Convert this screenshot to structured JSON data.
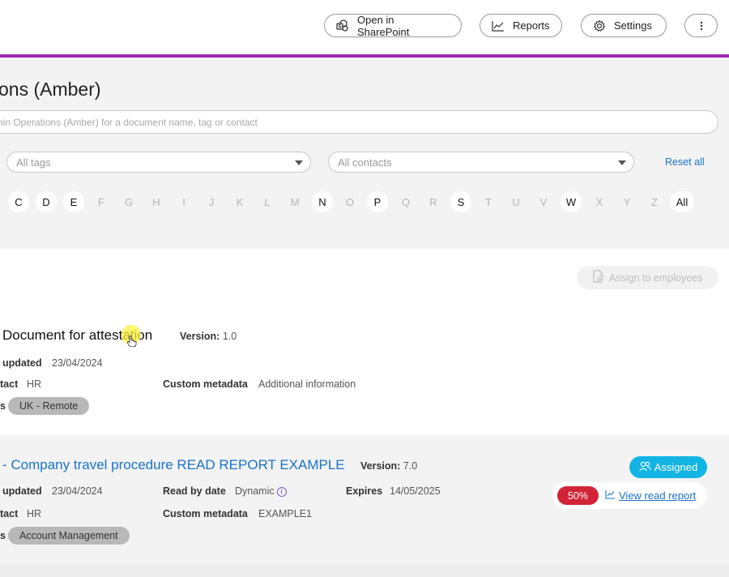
{
  "toolbar": {
    "open_sharepoint": "Open in SharePoint",
    "reports": "Reports",
    "settings": "Settings",
    "more_icon": "more-vertical-icon"
  },
  "filters": {
    "title": "ons (Amber)",
    "search_placeholder": "hin Operations (Amber) for a document name, tag or contact",
    "tags_placeholder": "All tags",
    "contacts_placeholder": "All contacts",
    "reset_all": "Reset all",
    "letters": [
      {
        "label": "C",
        "active": true
      },
      {
        "label": "D",
        "active": true
      },
      {
        "label": "E",
        "active": true
      },
      {
        "label": "F",
        "active": false
      },
      {
        "label": "G",
        "active": false
      },
      {
        "label": "H",
        "active": false
      },
      {
        "label": "I",
        "active": false
      },
      {
        "label": "J",
        "active": false
      },
      {
        "label": "K",
        "active": false
      },
      {
        "label": "L",
        "active": false
      },
      {
        "label": "M",
        "active": false
      },
      {
        "label": "N",
        "active": true
      },
      {
        "label": "O",
        "active": false
      },
      {
        "label": "P",
        "active": true
      },
      {
        "label": "Q",
        "active": false
      },
      {
        "label": "R",
        "active": false
      },
      {
        "label": "S",
        "active": true
      },
      {
        "label": "T",
        "active": false
      },
      {
        "label": "U",
        "active": false
      },
      {
        "label": "V",
        "active": false
      },
      {
        "label": "W",
        "active": true
      },
      {
        "label": "X",
        "active": false
      },
      {
        "label": "Y",
        "active": false
      },
      {
        "label": "Z",
        "active": false
      },
      {
        "label": "All",
        "active": true
      }
    ]
  },
  "actions": {
    "assign_label": "Assign to employees"
  },
  "documents": [
    {
      "title": "Document for attestation",
      "version_label": "Version:",
      "version": "1.0",
      "updated_label": "updated",
      "updated": "23/04/2024",
      "contact_label": "tact",
      "contact": "HR",
      "meta_label": "Custom metadata",
      "meta": "Additional information",
      "tags_label": "s",
      "tag": "UK - Remote"
    },
    {
      "title": "- Company travel procedure READ REPORT EXAMPLE",
      "version_label": "Version:",
      "version": "7.0",
      "updated_label": "updated",
      "updated": "23/04/2024",
      "read_by_label": "Read by date",
      "read_by": "Dynamic",
      "expires_label": "Expires",
      "expires": "14/05/2025",
      "contact_label": "tact",
      "contact": "HR",
      "meta_label": "Custom metadata",
      "meta": "EXAMPLE1",
      "tags_label": "s",
      "tag": "Account Management",
      "status": "Assigned",
      "read_percent": "50%",
      "view_report": "View read report"
    }
  ],
  "colors": {
    "accent": "#9b27af",
    "link": "#1a73c8",
    "assigned": "#12b4e3",
    "percent": "#d22437"
  }
}
